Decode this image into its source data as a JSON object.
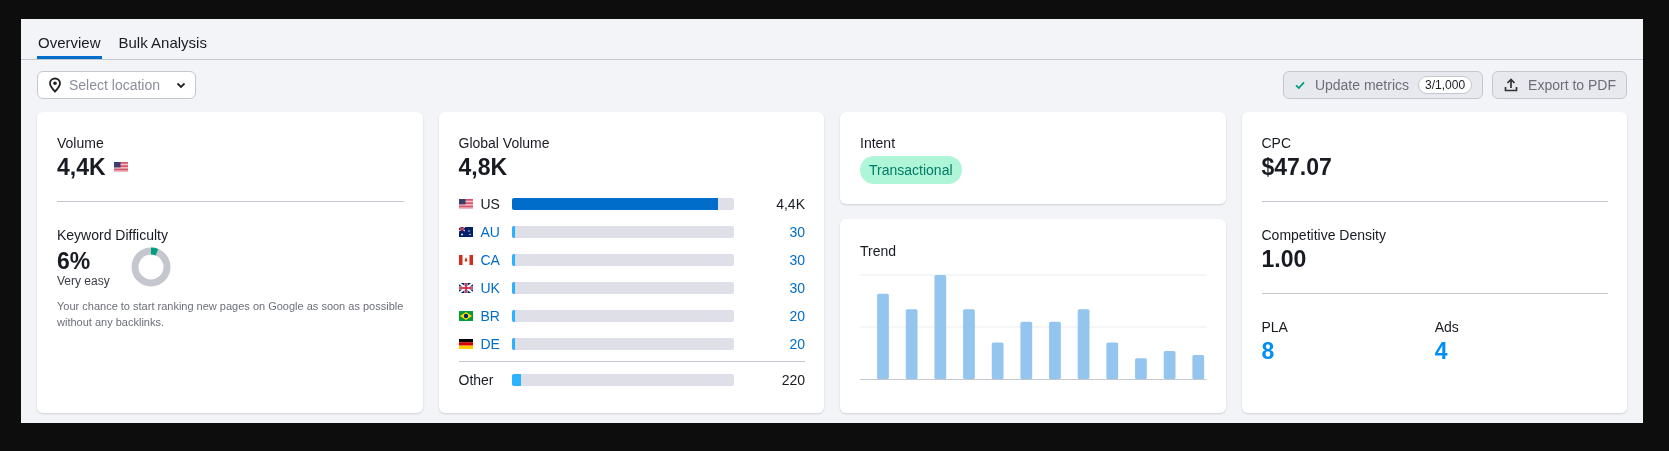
{
  "tabs": [
    {
      "label": "Overview",
      "selected": true
    },
    {
      "label": "Bulk Analysis",
      "selected": false
    }
  ],
  "location": {
    "placeholder": "Select location"
  },
  "actions": {
    "update": {
      "label": "Update metrics",
      "count": "3/1,000"
    },
    "export": {
      "label": "Export to PDF"
    }
  },
  "volume": {
    "label": "Volume",
    "value": "4,4K"
  },
  "keyword_difficulty": {
    "label": "Keyword Difficulty",
    "value": "6%",
    "rating": "Very easy",
    "level": 0.06,
    "color": "#009f81",
    "description": "Your chance to start ranking new pages on Google as soon as possible without any backlinks."
  },
  "global_volume": {
    "label": "Global Volume",
    "value": "4,8K",
    "rows": [
      {
        "country": "US",
        "value": "4,4K",
        "level": 0.93,
        "linked": false
      },
      {
        "country": "AU",
        "value": "30",
        "level": 0.012,
        "linked": true
      },
      {
        "country": "CA",
        "value": "30",
        "level": 0.012,
        "linked": true
      },
      {
        "country": "UK",
        "value": "30",
        "level": 0.012,
        "linked": true
      },
      {
        "country": "BR",
        "value": "20",
        "level": 0.012,
        "linked": true
      },
      {
        "country": "DE",
        "value": "20",
        "level": 0.012,
        "linked": true
      }
    ],
    "other": {
      "label": "Other",
      "value": "220",
      "level": 0.045
    }
  },
  "intent": {
    "label": "Intent",
    "tag": "Transactional"
  },
  "trend": {
    "label": "Trend"
  },
  "cpc": {
    "label": "CPC",
    "value": "$47.07"
  },
  "competitive_density": {
    "label": "Competitive Density",
    "value": "1.00"
  },
  "pla": {
    "label": "PLA",
    "value": "8"
  },
  "ads": {
    "label": "Ads",
    "value": "4"
  }
}
